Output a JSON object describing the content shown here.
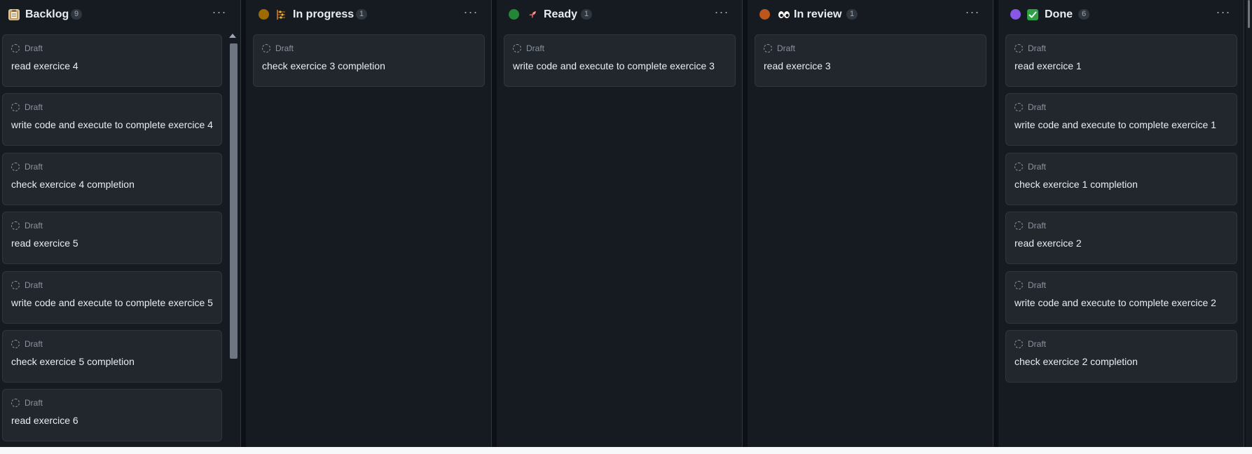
{
  "columns": [
    {
      "title": "Backlog",
      "count": "9",
      "icon": "clipboard-icon",
      "dot_color": "",
      "cards": [
        {
          "status": "Draft",
          "title": "read exercice 4"
        },
        {
          "status": "Draft",
          "title": "write code and execute to complete exercice 4"
        },
        {
          "status": "Draft",
          "title": "check exercice 4 completion"
        },
        {
          "status": "Draft",
          "title": "read exercice 5"
        },
        {
          "status": "Draft",
          "title": "write code and execute to complete exercice 5"
        },
        {
          "status": "Draft",
          "title": "check exercice 5 completion"
        },
        {
          "status": "Draft",
          "title": "read exercice 6"
        }
      ]
    },
    {
      "title": "In progress",
      "count": "1",
      "icon": "abacus-icon",
      "dot_color": "#9e6a03",
      "cards": [
        {
          "status": "Draft",
          "title": "check exercice 3 completion"
        }
      ]
    },
    {
      "title": "Ready",
      "count": "1",
      "icon": "rocket-icon",
      "dot_color": "#238636",
      "cards": [
        {
          "status": "Draft",
          "title": "write code and execute to complete exercice 3"
        }
      ]
    },
    {
      "title": "In review",
      "count": "1",
      "icon": "eyes-icon",
      "dot_color": "#bd561d",
      "cards": [
        {
          "status": "Draft",
          "title": "read exercice 3"
        }
      ]
    },
    {
      "title": "Done",
      "count": "6",
      "icon": "check-mark-icon",
      "dot_color": "#8957e5",
      "cards": [
        {
          "status": "Draft",
          "title": "read exercice 1"
        },
        {
          "status": "Draft",
          "title": "write code and execute to complete exercice 1"
        },
        {
          "status": "Draft",
          "title": "check exercice 1 completion"
        },
        {
          "status": "Draft",
          "title": "read exercice 2"
        },
        {
          "status": "Draft",
          "title": "write code and execute to complete exercice 2"
        },
        {
          "status": "Draft",
          "title": "check exercice 2 completion"
        }
      ]
    }
  ],
  "colors": {
    "background": "#0d1117",
    "column": "#161b22",
    "card": "#22272e",
    "border": "#30363d",
    "text": "#e6edf3",
    "muted": "#8b949e"
  }
}
